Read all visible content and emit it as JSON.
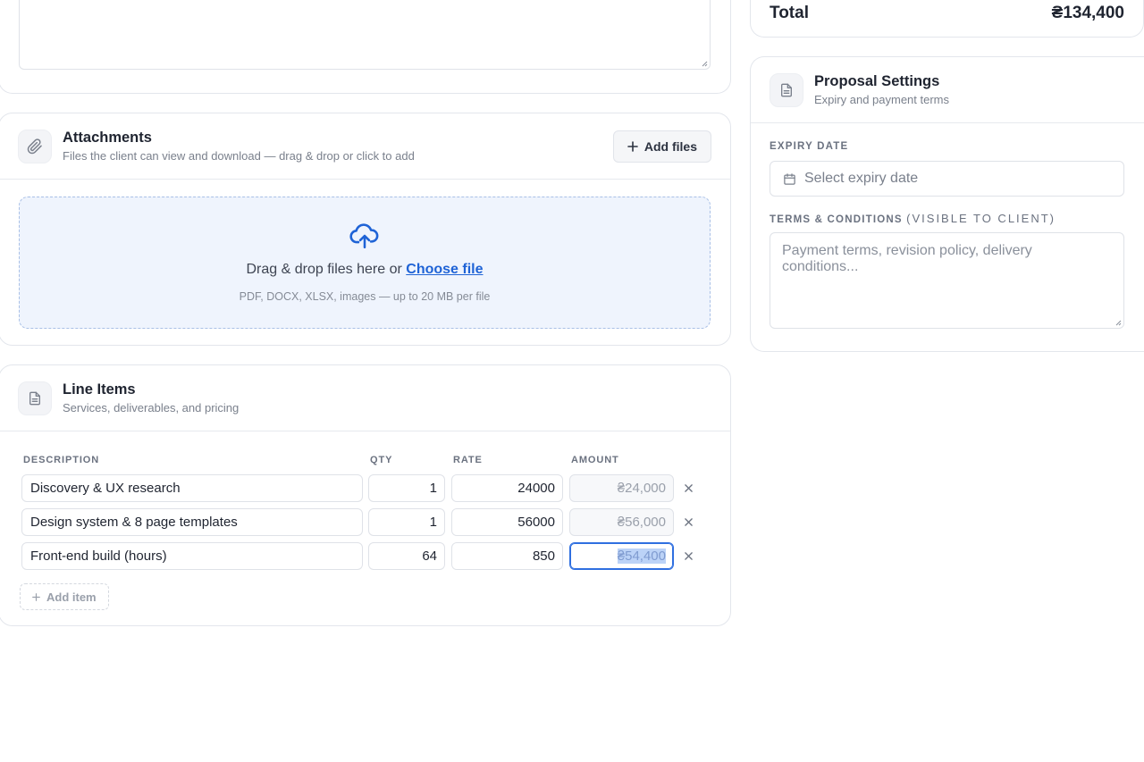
{
  "attachments": {
    "title": "Attachments",
    "subtitle": "Files the client can view and download — drag & drop or click to add",
    "add_files_label": "Add files",
    "dropzone_text": "Drag & drop files here or",
    "dropzone_link": "Choose file",
    "dropzone_hint": "PDF, DOCX, XLSX, images — up to 20 MB per file",
    "icons": {
      "header": "paperclip-icon",
      "upload": "cloud-upload-icon",
      "add": "plus-icon"
    }
  },
  "line_items": {
    "title": "Line Items",
    "subtitle": "Services, deliverables, and pricing",
    "columns": {
      "description": "DESCRIPTION",
      "qty": "QTY",
      "rate": "RATE",
      "amount": "AMOUNT"
    },
    "rows": [
      {
        "description": "Discovery & UX research",
        "qty": "1",
        "rate": "24000",
        "amount": "₴24,000"
      },
      {
        "description": "Design system & 8 page templates",
        "qty": "1",
        "rate": "56000",
        "amount": "₴56,000"
      },
      {
        "description": "Front-end build (hours)",
        "qty": "64",
        "rate": "850",
        "amount": "₴54,400"
      }
    ],
    "add_item_label": "Add item",
    "icons": {
      "header": "document-icon",
      "remove": "close-icon"
    }
  },
  "summary": {
    "total_label": "Total",
    "total_value": "₴134,400"
  },
  "proposal_settings": {
    "title": "Proposal Settings",
    "subtitle": "Expiry and payment terms",
    "expiry_label": "EXPIRY DATE",
    "expiry_placeholder": "Select expiry date",
    "terms_label": "TERMS & CONDITIONS",
    "terms_label_note": "(VISIBLE TO CLIENT)",
    "terms_placeholder": "Payment terms, revision policy, delivery conditions...",
    "icons": {
      "header": "document-icon",
      "calendar": "calendar-icon"
    }
  },
  "colors": {
    "accent": "#1f63d6",
    "dropzone_bg": "#eff4fd",
    "border": "#e3e6ec"
  }
}
